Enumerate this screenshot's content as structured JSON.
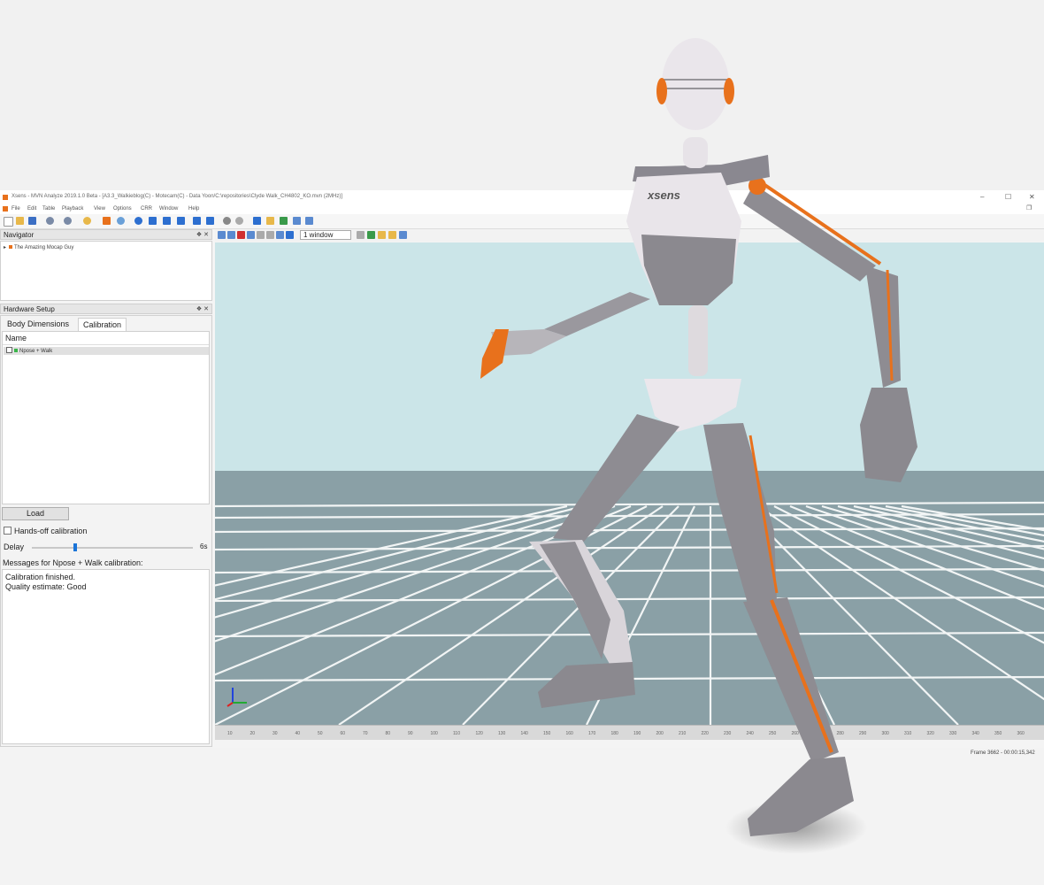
{
  "window": {
    "title": "Xsens - MVN Analyze 2019.1.0 Beta - [A3.3_Walkieblog(C) - Motecam(C) - Data Yoon/C:\\repositories\\Clyde Walk_CH4802_KO.mvn (2MHz)]",
    "minimize": "–",
    "maximize": "☐",
    "close": "✕",
    "restore": "❐"
  },
  "menu": [
    "File",
    "Edit",
    "Table",
    "Playback",
    "View",
    "Options",
    "CRR",
    "Window",
    "Help"
  ],
  "colors": {
    "accent": "#e8711c",
    "sky": "#cbe5e8",
    "floor": "#8aa0a6",
    "panel": "#f3f3f3"
  },
  "navigator": {
    "title": "Navigator",
    "pin": "❖ ✕",
    "item": "The Amazing Mocap Guy"
  },
  "hardware": {
    "title": "Hardware Setup",
    "pin": "❖ ✕",
    "tabs": [
      "Body Dimensions",
      "Calibration"
    ],
    "active_tab": "Calibration",
    "name_header": "Name",
    "row": "Npose + Walk",
    "load_label": "Load",
    "hands_off_label": "Hands-off calibration",
    "hands_off_checked": false,
    "delay_label": "Delay",
    "delay_value": "6s",
    "delay_fraction": 0.26,
    "messages_label": "Messages for Npose + Walk calibration:",
    "messages": [
      "Calibration finished.",
      "Quality estimate: Good"
    ]
  },
  "viewport": {
    "window_select": "1 window",
    "timeline_ticks": [
      "10",
      "20",
      "30",
      "40",
      "50",
      "60",
      "70",
      "80",
      "90",
      "100",
      "110",
      "120",
      "130",
      "140",
      "150",
      "160",
      "170",
      "180",
      "190",
      "200",
      "210",
      "220",
      "230",
      "240",
      "250",
      "260",
      "270",
      "280",
      "290",
      "300",
      "310",
      "320",
      "330",
      "340",
      "350",
      "360"
    ]
  },
  "status": {
    "frame": "Frame 3662 - 00:00:15,342"
  },
  "figure": {
    "logo": "xsens"
  }
}
